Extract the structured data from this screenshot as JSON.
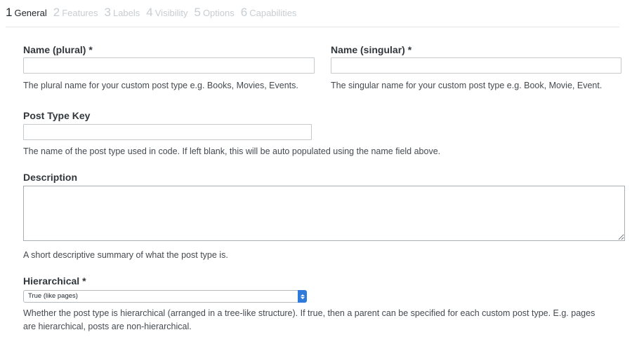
{
  "tabs": [
    {
      "num": "1",
      "label": "General"
    },
    {
      "num": "2",
      "label": "Features"
    },
    {
      "num": "3",
      "label": "Labels"
    },
    {
      "num": "4",
      "label": "Visibility"
    },
    {
      "num": "5",
      "label": "Options"
    },
    {
      "num": "6",
      "label": "Capabilities"
    }
  ],
  "required_marker": "*",
  "fields": {
    "name_plural": {
      "label": "Name (plural)",
      "value": "",
      "help": "The plural name for your custom post type e.g. Books, Movies, Events."
    },
    "name_singular": {
      "label": "Name (singular)",
      "value": "",
      "help": "The singular name for your custom post type e.g. Book, Movie, Event."
    },
    "post_type_key": {
      "label": "Post Type Key",
      "value": "",
      "help": "The name of the post type used in code. If left blank, this will be auto populated using the name field above."
    },
    "description": {
      "label": "Description",
      "value": "",
      "help": "A short descriptive summary of what the post type is."
    },
    "hierarchical": {
      "label": "Hierarchical",
      "selected": "True (like pages)",
      "help_line1": "Whether the post type is hierarchical (arranged in a tree-like structure). If true, then a parent can be specified for each custom post type. E.g. pages",
      "help_line2": "are hierarchical, posts are non-hierarchical."
    }
  }
}
